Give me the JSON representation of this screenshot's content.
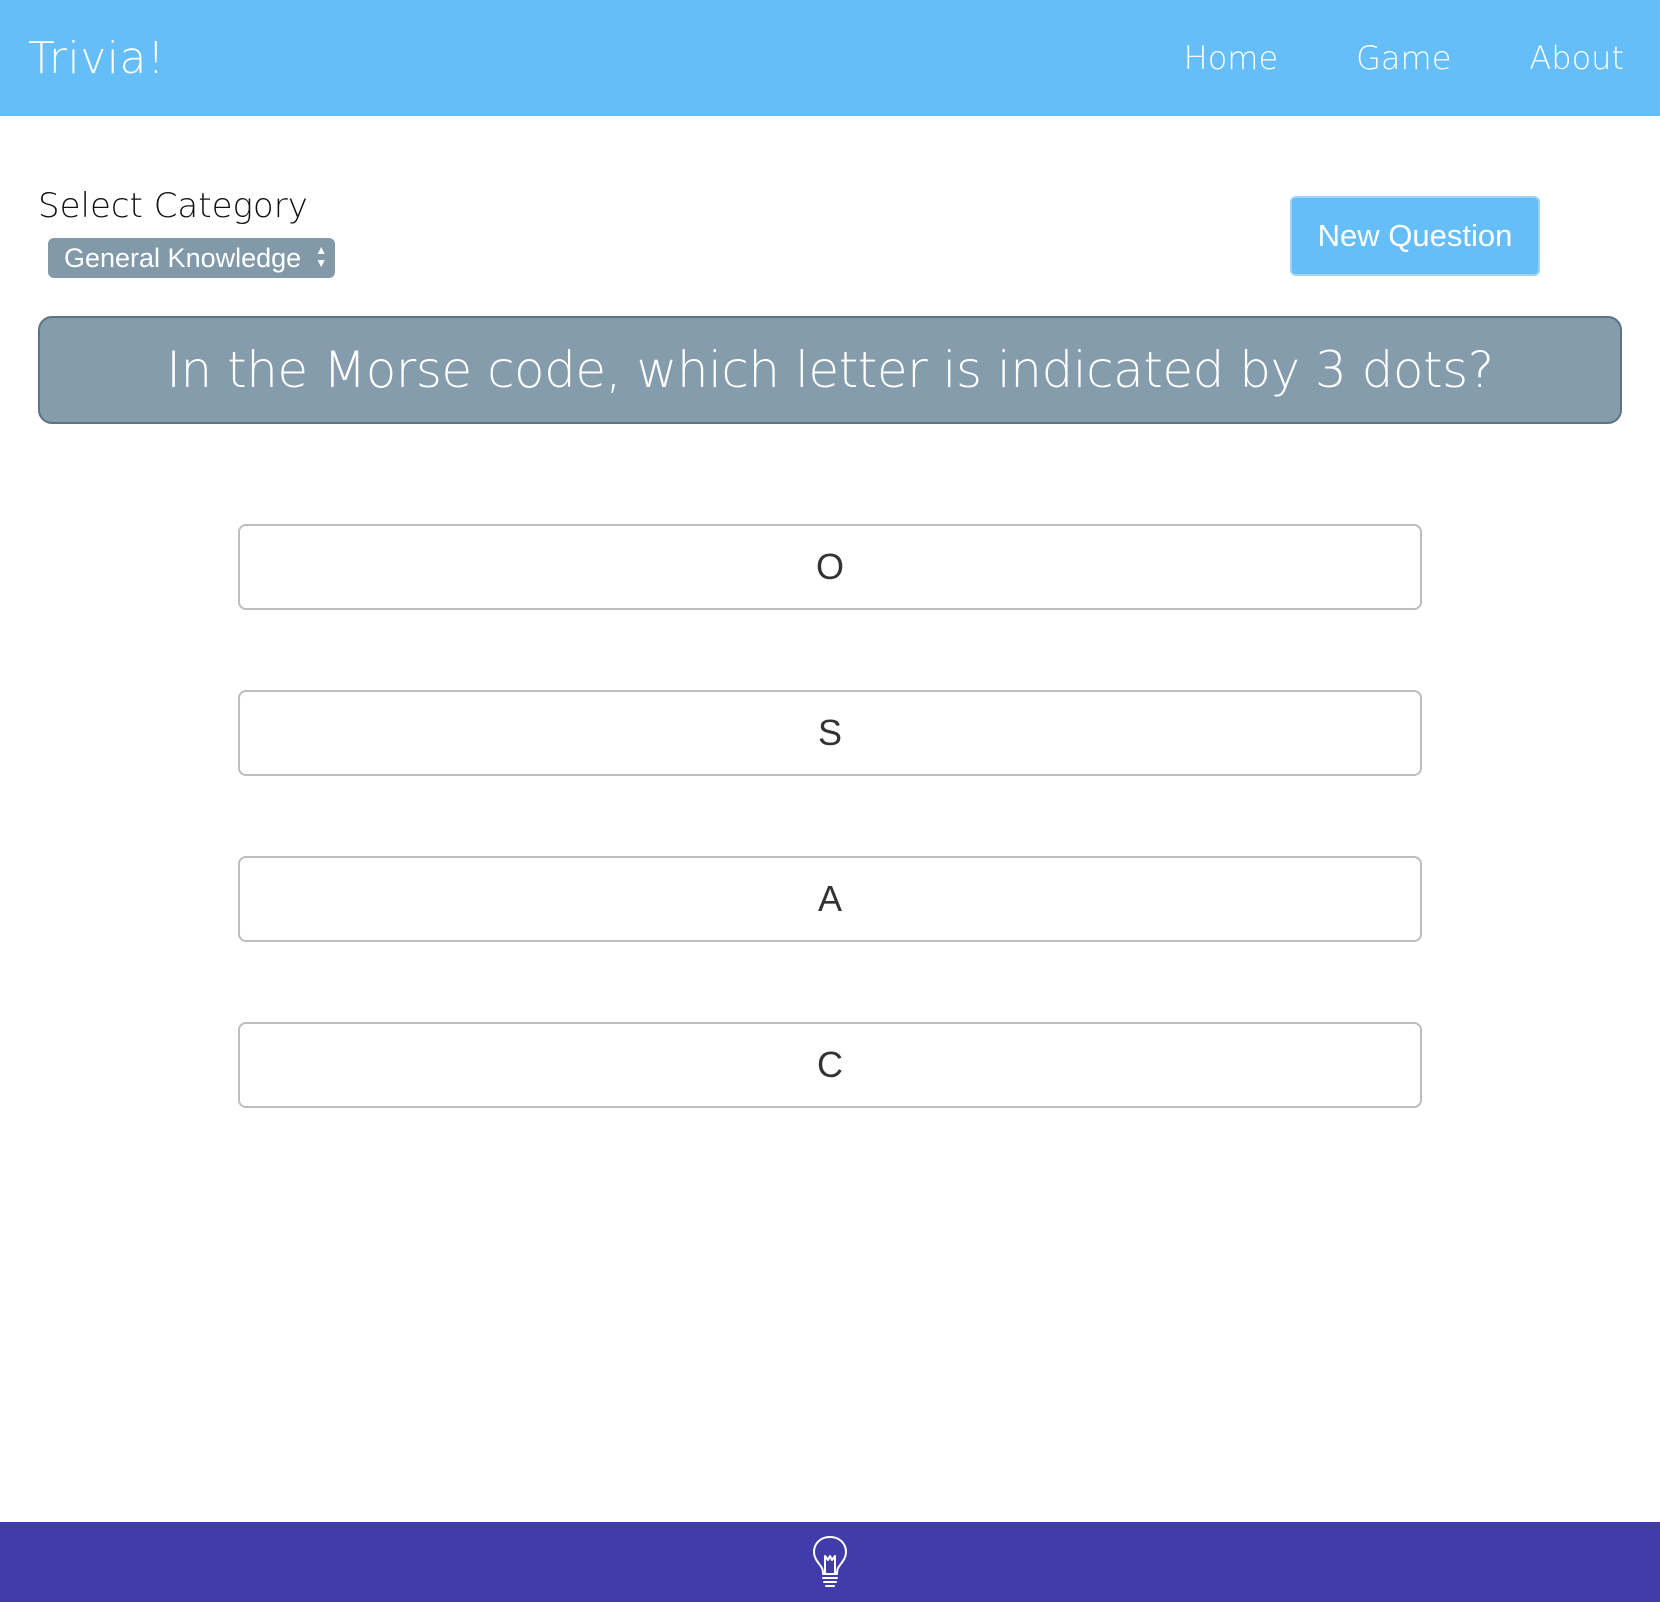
{
  "navbar": {
    "brand": "Trivia!",
    "links": [
      {
        "label": "Home"
      },
      {
        "label": "Game"
      },
      {
        "label": "About"
      }
    ]
  },
  "controls": {
    "category_label": "Select Category",
    "selected_category": "General Knowledge",
    "new_question_label": "New Question"
  },
  "question": {
    "text": "In the Morse code, which letter is indicated by 3 dots?"
  },
  "answers": [
    {
      "label": "O"
    },
    {
      "label": "S"
    },
    {
      "label": "A"
    },
    {
      "label": "C"
    }
  ],
  "footer": {
    "icon": "lightbulb-icon"
  },
  "colors": {
    "navbar": "#66bef9",
    "banner": "#849cab",
    "select": "#8199a8",
    "footer": "#423baa"
  }
}
